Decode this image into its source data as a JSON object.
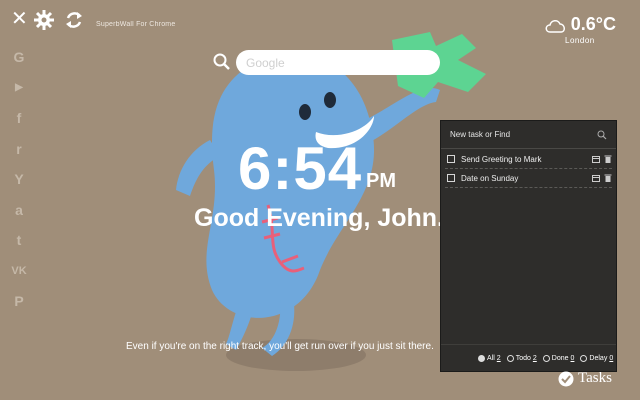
{
  "toolbar": {
    "site_title": "SuperbWall For Chrome"
  },
  "weather": {
    "temperature": "0.6°C",
    "city": "London"
  },
  "social": [
    "G",
    "▶",
    "f",
    "r",
    "Y",
    "a",
    "t",
    "VK",
    "P"
  ],
  "search": {
    "placeholder": "Google"
  },
  "clock": {
    "time": "6:54",
    "ampm": "PM"
  },
  "greeting": "Good Evening, John.",
  "quote": "Even if you're on the right track, you'll get run over if you just sit there.",
  "tasks": {
    "input_placeholder": "New task or Find",
    "items": [
      {
        "text": "Send Greeting to Mark"
      },
      {
        "text": "Date on Sunday"
      }
    ],
    "filters": [
      {
        "label": "All",
        "count": "2"
      },
      {
        "label": "Todo",
        "count": "2"
      },
      {
        "label": "Done",
        "count": "0"
      },
      {
        "label": "Delay",
        "count": "0"
      }
    ],
    "button_label": "Tasks"
  },
  "colors": {
    "background": "#a08e79",
    "character": "#6fa8dc",
    "panel": "#2e2d2b",
    "money": "#5dd492",
    "scar": "#e8607a"
  }
}
